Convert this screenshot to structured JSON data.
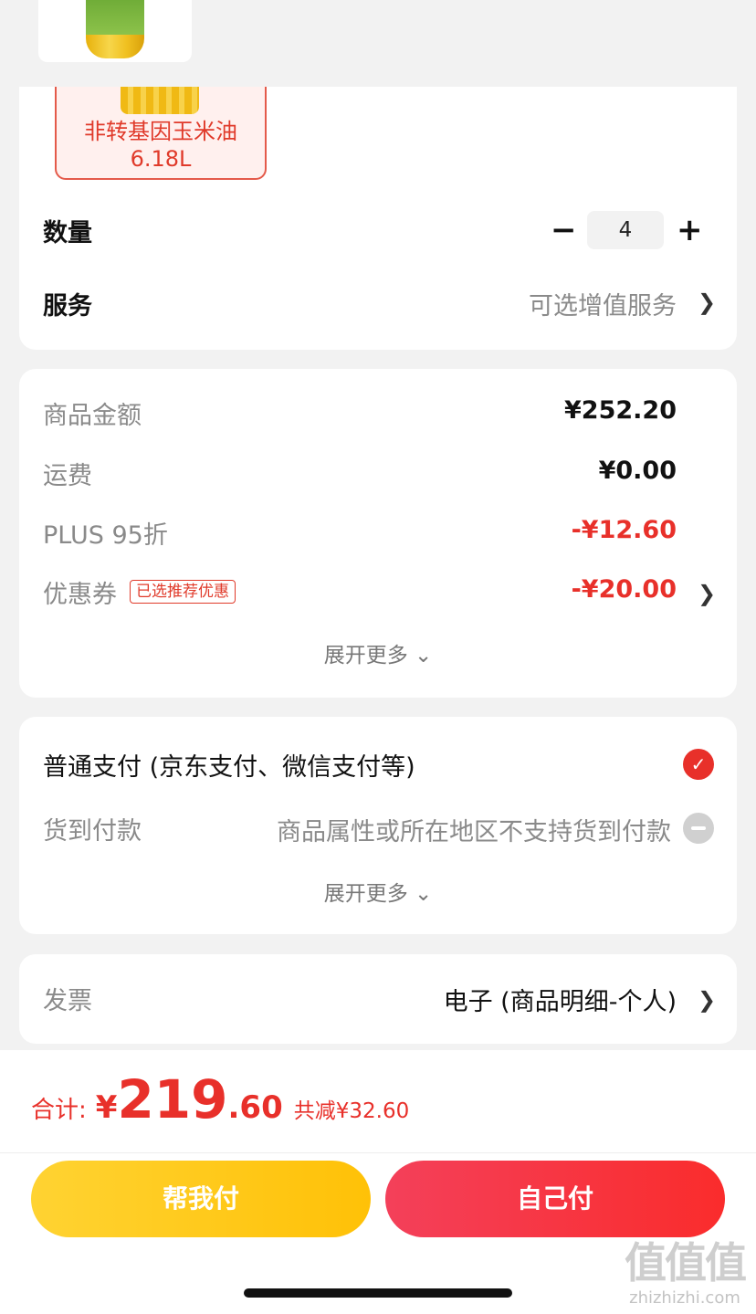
{
  "product": {
    "variant_label": "非转基因玉米油\n6.18L",
    "quantity_label": "数量",
    "quantity_minus": "−",
    "quantity_value": "4",
    "quantity_plus": "+",
    "service_label": "服务",
    "service_value": "可选增值服务"
  },
  "price": {
    "goods_label": "商品金额",
    "goods_value": "¥252.20",
    "shipping_label": "运费",
    "shipping_value": "¥0.00",
    "plus_label": "PLUS 95折",
    "plus_value": "-¥12.60",
    "coupon_label": "优惠券",
    "coupon_tag": "已选推荐优惠",
    "coupon_value": "-¥20.00",
    "expand_more": "展开更多 ⌄"
  },
  "payment": {
    "normal_label": "普通支付 (京东支付、微信支付等)",
    "cod_label": "货到付款",
    "cod_note": "商品属性或所在地区不支持货到付款",
    "expand_more": "展开更多 ⌄"
  },
  "invoice": {
    "label": "发票",
    "value": "电子 (商品明细-个人)"
  },
  "footer": {
    "total_label": "合计:",
    "currency": "¥",
    "total_integer": "219",
    "total_decimal": ".60",
    "saved_text": "共减¥32.60",
    "help_pay": "帮我付",
    "self_pay": "自己付"
  },
  "watermark": {
    "big": "值值值",
    "small": "zhizhizhi.com"
  },
  "colors": {
    "accent_red": "#e8302a",
    "yellow_button": "#ffc107",
    "red_button": "#fa2c2c"
  },
  "icons": {
    "chevron": "chevron-right-icon",
    "check": "check-circle-icon",
    "disabled": "minus-circle-icon"
  }
}
